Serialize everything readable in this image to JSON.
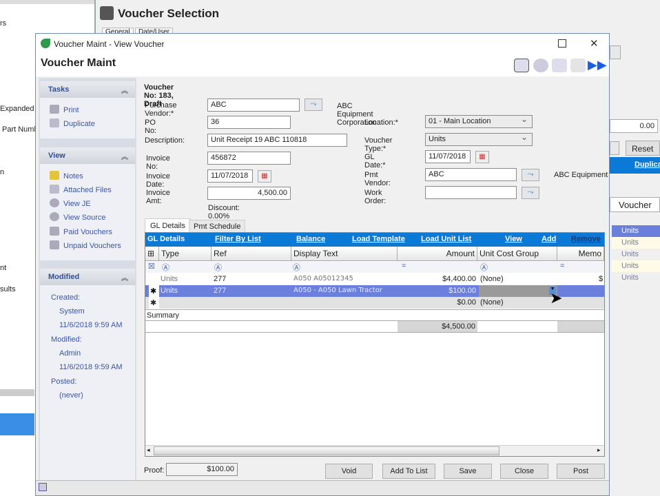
{
  "background": {
    "left_texts": [
      "rs",
      "Expanded",
      "Part Numb",
      "n",
      "nt",
      "sults"
    ],
    "window_title": "Voucher Selection",
    "tabs": [
      "General",
      "Date/User"
    ],
    "amount": "0.00",
    "reset": "Reset",
    "duplicate": "Duplica",
    "voucher_col": "Voucher",
    "rows": [
      "Units",
      "Units",
      "Units",
      "Units",
      "Units"
    ]
  },
  "window": {
    "title": "Voucher Maint - View Voucher",
    "header": "Voucher Maint"
  },
  "sidebar": {
    "tasks": {
      "title": "Tasks",
      "items": [
        "Print",
        "Duplicate"
      ]
    },
    "view": {
      "title": "View",
      "items": [
        "Notes",
        "Attached Files",
        "View JE",
        "View Source",
        "Paid Vouchers",
        "Unpaid Vouchers"
      ]
    },
    "modified": {
      "title": "Modified",
      "created_label": "Created:",
      "created_by": "System",
      "created_at": "11/6/2018 9:59 AM",
      "modified_label": "Modified:",
      "modified_by": "Admin",
      "modified_at": "11/6/2018 9:59 AM",
      "posted_label": "Posted:",
      "posted": "(never)"
    }
  },
  "form": {
    "voucher_no": "Voucher No: 183, Draft",
    "purchase_vendor_label": "Purchase Vendor:*",
    "purchase_vendor": "ABC",
    "vendor_name": "ABC Equipment Corporation",
    "po_label": "PO No:",
    "po": "36",
    "desc_label": "Description:",
    "desc": "Unit Receipt 19 ABC 110818",
    "inv_no_label": "Invoice No:",
    "inv_no": "456872",
    "inv_date_label": "Invoice Date:",
    "inv_date": "11/07/2018",
    "inv_amt_label": "Invoice Amt:",
    "inv_amt": "4,500.00",
    "discount": "Discount: 0.00%",
    "location_label": "Location:*",
    "location": "01 - Main Location",
    "vtype_label": "Voucher Type:*",
    "vtype": "Units",
    "gl_date_label": "GL Date:*",
    "gl_date": "11/07/2018",
    "pmt_vendor_label": "Pmt Vendor:",
    "pmt_vendor": "ABC",
    "pmt_vendor_name": "ABC Equipment C",
    "wo_label": "Work Order:",
    "wo": ""
  },
  "tabs": [
    "GL Details",
    "Pmt Schedule"
  ],
  "grid": {
    "toolbar": [
      "GL Details",
      "Filter By List",
      "Balance",
      "Load Template",
      "Load Unit List",
      "View",
      "Add",
      "Remove"
    ],
    "columns": [
      "Type",
      "Ref",
      "Display Text",
      "Amount",
      "Unit Cost Group",
      "Memo"
    ],
    "rows": [
      {
        "type": "Units",
        "ref": "277",
        "text": "A050 A05012345",
        "amount": "$4,400.00",
        "ucg": "(None)",
        "memo": "$"
      },
      {
        "type": "Units",
        "ref": "277",
        "text": "A050 - A050 Lawn Tractor",
        "amount": "$100.00",
        "ucg": "",
        "memo": ""
      },
      {
        "type": "",
        "ref": "",
        "text": "",
        "amount": "$0.00",
        "ucg": "(None)",
        "memo": ""
      }
    ],
    "summary_label": "Summary",
    "summary_amount": "$4,500.00"
  },
  "footer": {
    "proof_label": "Proof:",
    "proof": "$100.00",
    "buttons": [
      "Void",
      "Add To List",
      "Save",
      "Close",
      "Post"
    ]
  }
}
